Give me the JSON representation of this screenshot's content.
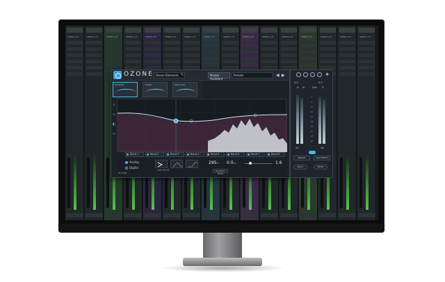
{
  "plugin": {
    "app_name": "OZONE",
    "preset_name": "Ozone Elements",
    "assistant_label": "Master Assistant",
    "presets_label": "Presets",
    "modules": [
      {
        "label": "Equalizer"
      },
      {
        "label": "Imager"
      },
      {
        "label": "Maximizer"
      }
    ],
    "bands": [
      "Band 1",
      "Band 2",
      "Band 3",
      "Band 4",
      "Band 5",
      "Band 6",
      "Band 7",
      "Band 8"
    ],
    "mode": {
      "analog": "Analog",
      "digital": "Digital"
    },
    "shape_label": "Low Shelf",
    "shape_group_label": "Analog",
    "freq_value": "295",
    "freq_unit": "Hz",
    "gain_value": "0.0",
    "gain_unit": "dB",
    "dynamic_eq_label": "Dynamic Mode",
    "q_value": "1.6",
    "colors": {
      "accent": "#4fb6e8",
      "band_orange": "#e2a040"
    }
  },
  "meter": {
    "left_peak": "-4",
    "right_peak": "-3",
    "input_label": "In",
    "output_label": "Out",
    "top_left": "0.0",
    "top_right": "0.0",
    "bottom_left": "-14",
    "bottom_right": "-14",
    "bypass_label": "Bypass",
    "gain_match_label": "Gain Match",
    "codec_label": "Mono",
    "dither_label": "Dither"
  },
  "daw": {
    "strip_labels": [
      "SENDS A-E",
      "SENDS A-E",
      "SENDS A-E",
      "SENDS A-E",
      "SENDS A-E",
      "SENDS A-E",
      "SENDS A-E",
      "SENDS A-E",
      "SENDS A-E",
      "SENDS A-E",
      "SENDS A-E",
      "SENDS A-E",
      "SENDS A-E",
      "SENDS A-E",
      "SENDS A-E",
      "SENDS A-E"
    ]
  }
}
